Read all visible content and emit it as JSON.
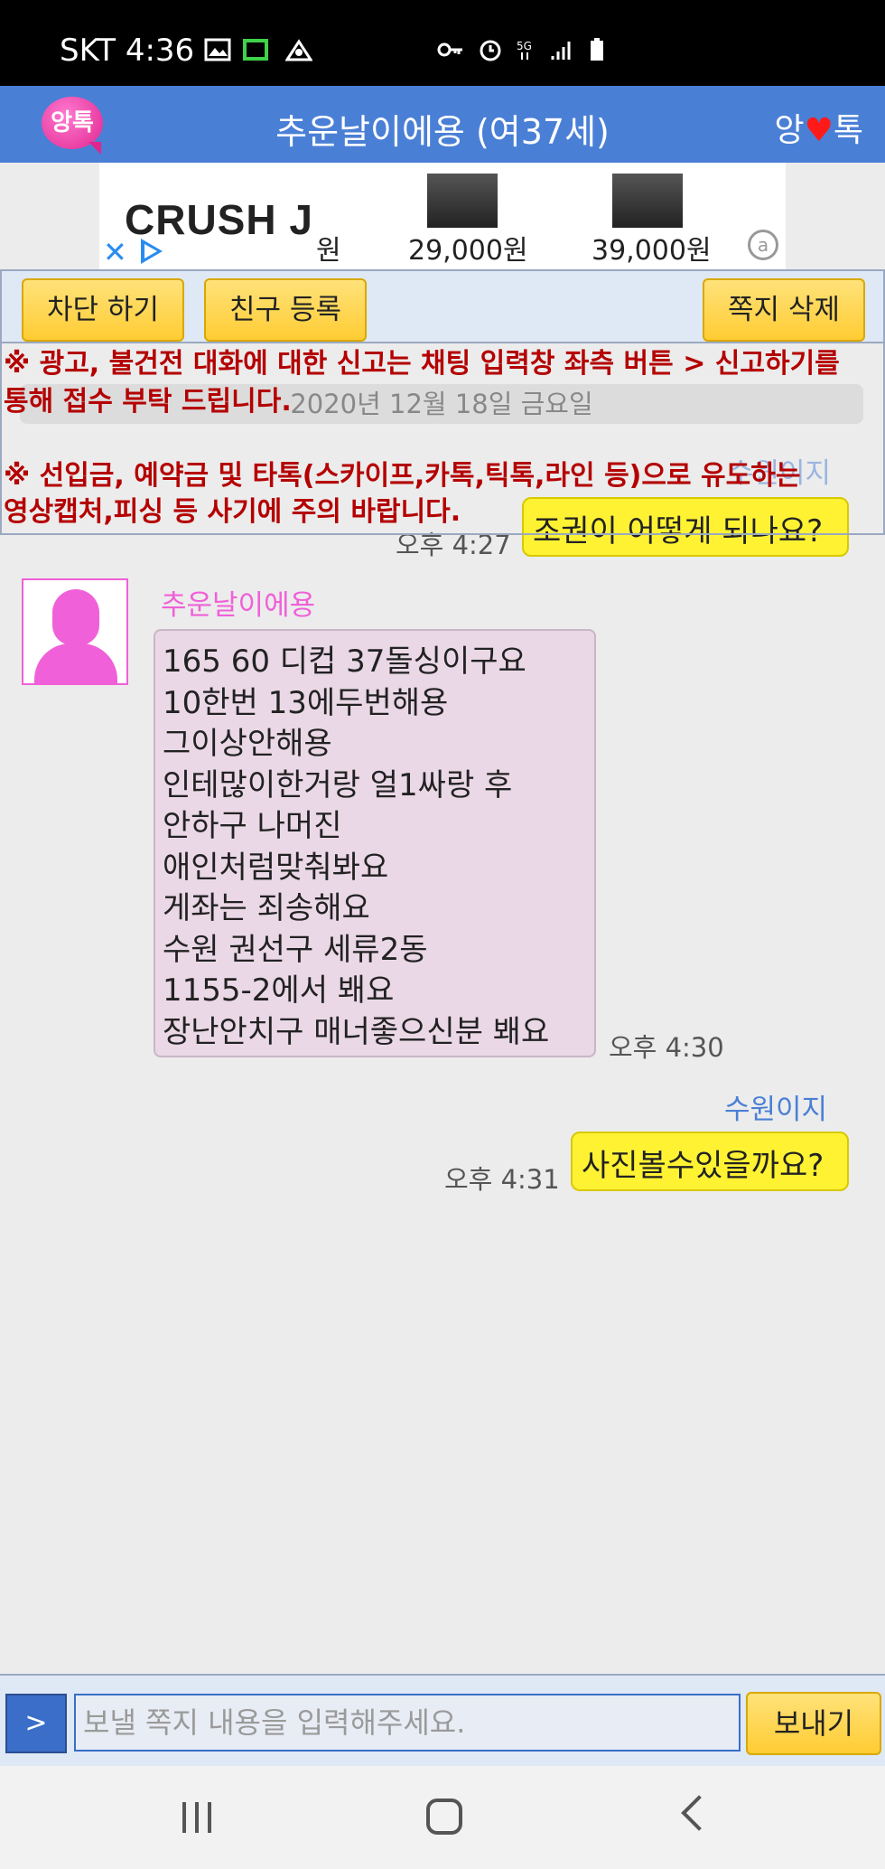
{
  "status_bar": {
    "carrier_time": "SKT 4:36",
    "icons": [
      "image-icon",
      "screen-icon",
      "app-icon",
      "key-icon",
      "alarm-icon",
      "5g-icon",
      "signal-icon",
      "battery-icon"
    ]
  },
  "header": {
    "logo_text": "앙톡",
    "title": "추운날이에용 (여37세)",
    "brand_left": "앙",
    "brand_heart": "♥",
    "brand_right": "톡"
  },
  "ad": {
    "brand": "CRUSH J",
    "left_fragment": "원",
    "price1": "29,000원",
    "price2": "39,000원",
    "info_symbol": "a"
  },
  "actions": {
    "block": "차단 하기",
    "add_friend": "친구 등록",
    "delete_note": "쪽지 삭제"
  },
  "notice": {
    "line1": "※ 광고, 불건전 대화에 대한 신고는 채팅 입력창 좌측 버튼 > 신고하기를",
    "line2": "통해 접수 부탁 드립니다.",
    "line3": "※ 선입금, 예약금 및 타톡(스카이프,카톡,틱톡,라인 등)으로 유도하는",
    "line4": "영상캡처,피싱 등 사기에 주의 바랍니다."
  },
  "chat": {
    "date": "2020년 12월 18일 금요일",
    "messages": [
      {
        "sender": "수원이지",
        "text": "조권이 어떻게 되나요?",
        "time": "오후 4:27"
      },
      {
        "sender": "추운날이에용",
        "lines": [
          "165 60 디컵 37돌싱이구요",
          "10한번 13에두번해용",
          "그이상안해용",
          "인테많이한거랑 얼1싸랑 후",
          "안하구 나머진",
          "애인처럼맞춰봐요",
          "게좌는 죄송해요",
          "수원 권선구 세류2동",
          "1155-2에서 봬요",
          "장난안치구 매너좋으신분 봬요"
        ],
        "time": "오후 4:30"
      },
      {
        "sender": "수원이지",
        "text": "사진볼수있을까요?",
        "time": "오후 4:31"
      }
    ]
  },
  "input": {
    "menu_label": ">",
    "placeholder": "보낼 쪽지 내용을 입력해주세요.",
    "send": "보내기"
  },
  "colors": {
    "header": "#4a7fd6",
    "sender_self": "#4a7fd6",
    "sender_other": "#f060d8",
    "notice": "#b40000"
  }
}
